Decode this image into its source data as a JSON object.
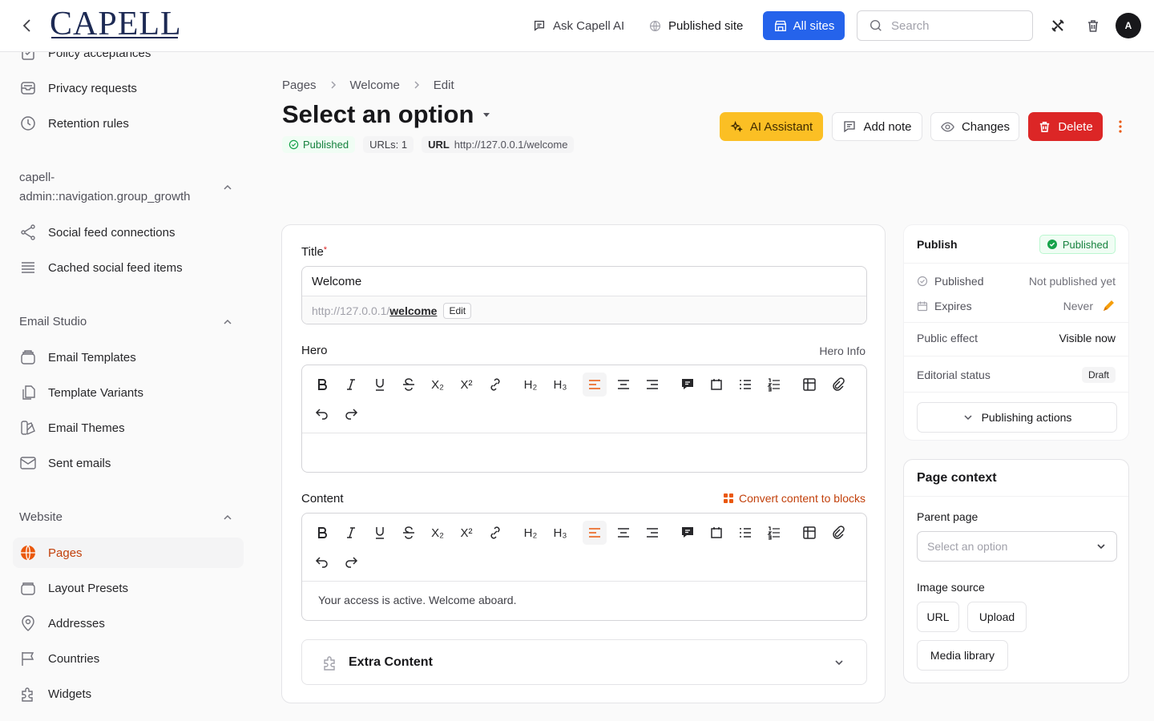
{
  "topbar": {
    "logo": "CAPELL",
    "ask_ai": "Ask Capell AI",
    "published_site": "Published site",
    "all_sites": "All sites",
    "search_placeholder": "Search",
    "avatar_initial": "A"
  },
  "sidebar": {
    "items_top": [
      {
        "label": "Policy acceptances",
        "icon": "check-doc-icon"
      },
      {
        "label": "Privacy requests",
        "icon": "inbox-icon"
      },
      {
        "label": "Retention rules",
        "icon": "clock-icon"
      }
    ],
    "group_growth": "capell-admin::navigation.group_growth",
    "growth_items": [
      {
        "label": "Social feed connections",
        "icon": "share-icon"
      },
      {
        "label": "Cached social feed items",
        "icon": "stack-icon"
      }
    ],
    "group_email": "Email Studio",
    "email_items": [
      {
        "label": "Email Templates",
        "icon": "template-icon"
      },
      {
        "label": "Template Variants",
        "icon": "copy-icon"
      },
      {
        "label": "Email Themes",
        "icon": "swatch-icon"
      },
      {
        "label": "Sent emails",
        "icon": "envelope-icon"
      }
    ],
    "group_website": "Website",
    "website_items": [
      {
        "label": "Pages",
        "icon": "globe-icon",
        "active": true
      },
      {
        "label": "Layout Presets",
        "icon": "layers-icon"
      },
      {
        "label": "Addresses",
        "icon": "map-pin-icon"
      },
      {
        "label": "Countries",
        "icon": "flag-icon"
      },
      {
        "label": "Widgets",
        "icon": "puzzle-icon"
      }
    ]
  },
  "breadcrumb": [
    "Pages",
    "Welcome",
    "Edit"
  ],
  "page": {
    "title": "Select an option",
    "status": "Published",
    "urls_count": "URLs: 1",
    "url_key": "URL",
    "url_value": "http://127.0.0.1/welcome"
  },
  "actions": {
    "ai": "AI Assistant",
    "note": "Add note",
    "changes": "Changes",
    "delete": "Delete"
  },
  "form": {
    "title_label": "Title",
    "title_required": "*",
    "title_value": "Welcome",
    "url_base": "http://127.0.0.1/",
    "url_slug": "welcome",
    "edit_label": "Edit",
    "hero_label": "Hero",
    "hero_hint": "Hero Info",
    "content_label": "Content",
    "convert_label": "Convert content to blocks",
    "content_body": "Your access is active. Welcome aboard.",
    "extra_label": "Extra Content",
    "toolbar_h2": "H₂",
    "toolbar_h3": "H₃",
    "toolbar_sub": "X₂",
    "toolbar_sup": "X²"
  },
  "publish": {
    "heading": "Publish",
    "badge": "Published",
    "published_label": "Published",
    "published_value": "Not published yet",
    "expires_label": "Expires",
    "expires_value": "Never",
    "effect_label": "Public effect",
    "effect_value": "Visible now",
    "editorial_label": "Editorial status",
    "editorial_value": "Draft",
    "actions_label": "Publishing actions"
  },
  "context": {
    "heading": "Page context",
    "parent_label": "Parent page",
    "parent_placeholder": "Select an option",
    "image_label": "Image source",
    "btn_url": "URL",
    "btn_upload": "Upload",
    "btn_media": "Media library"
  },
  "colors": {
    "accent": "#ea580c",
    "primary": "#2563eb",
    "danger": "#dc2626",
    "ai": "#fbbf24",
    "success": "#15803d"
  }
}
